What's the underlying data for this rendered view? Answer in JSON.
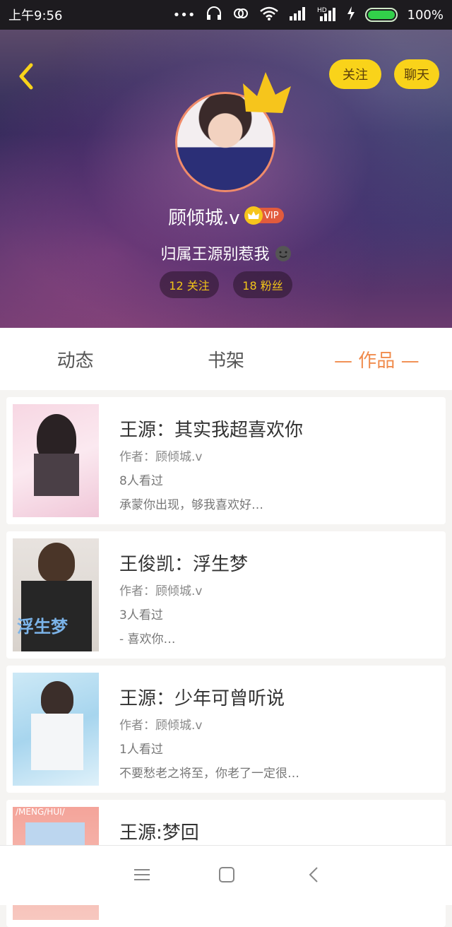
{
  "statusbar": {
    "time": "上午9:56",
    "battery": "100%"
  },
  "header": {
    "follow_label": "关注",
    "chat_label": "聊天",
    "nickname": "顾倾城.v",
    "vip_label": "VIP",
    "signature": "归属王源别惹我",
    "following": "12 关注",
    "fans": "18 粉丝"
  },
  "tabs": [
    {
      "label": "动态"
    },
    {
      "label": "书架"
    },
    {
      "label": "— 作品 —",
      "active": true
    }
  ],
  "works": [
    {
      "title": "王源：其实我超喜欢你",
      "author": "作者：顾倾城.v",
      "views": "8人看过",
      "desc": "承蒙你出现，够我喜欢好…"
    },
    {
      "title": "王俊凯：浮生梦",
      "author": "作者：顾倾城.v",
      "views": "3人看过",
      "desc": "- 喜欢你…",
      "cover_text": "浮生梦"
    },
    {
      "title": "王源：少年可曾听说",
      "author": "作者：顾倾城.v",
      "views": "1人看过",
      "desc": "不要愁老之将至，你老了一定很…"
    },
    {
      "title": "王源:梦回",
      "cover_text": "/MENG/HUI/"
    }
  ],
  "colors": {
    "accent": "#f08b4c",
    "yellow": "#f9d31a"
  }
}
